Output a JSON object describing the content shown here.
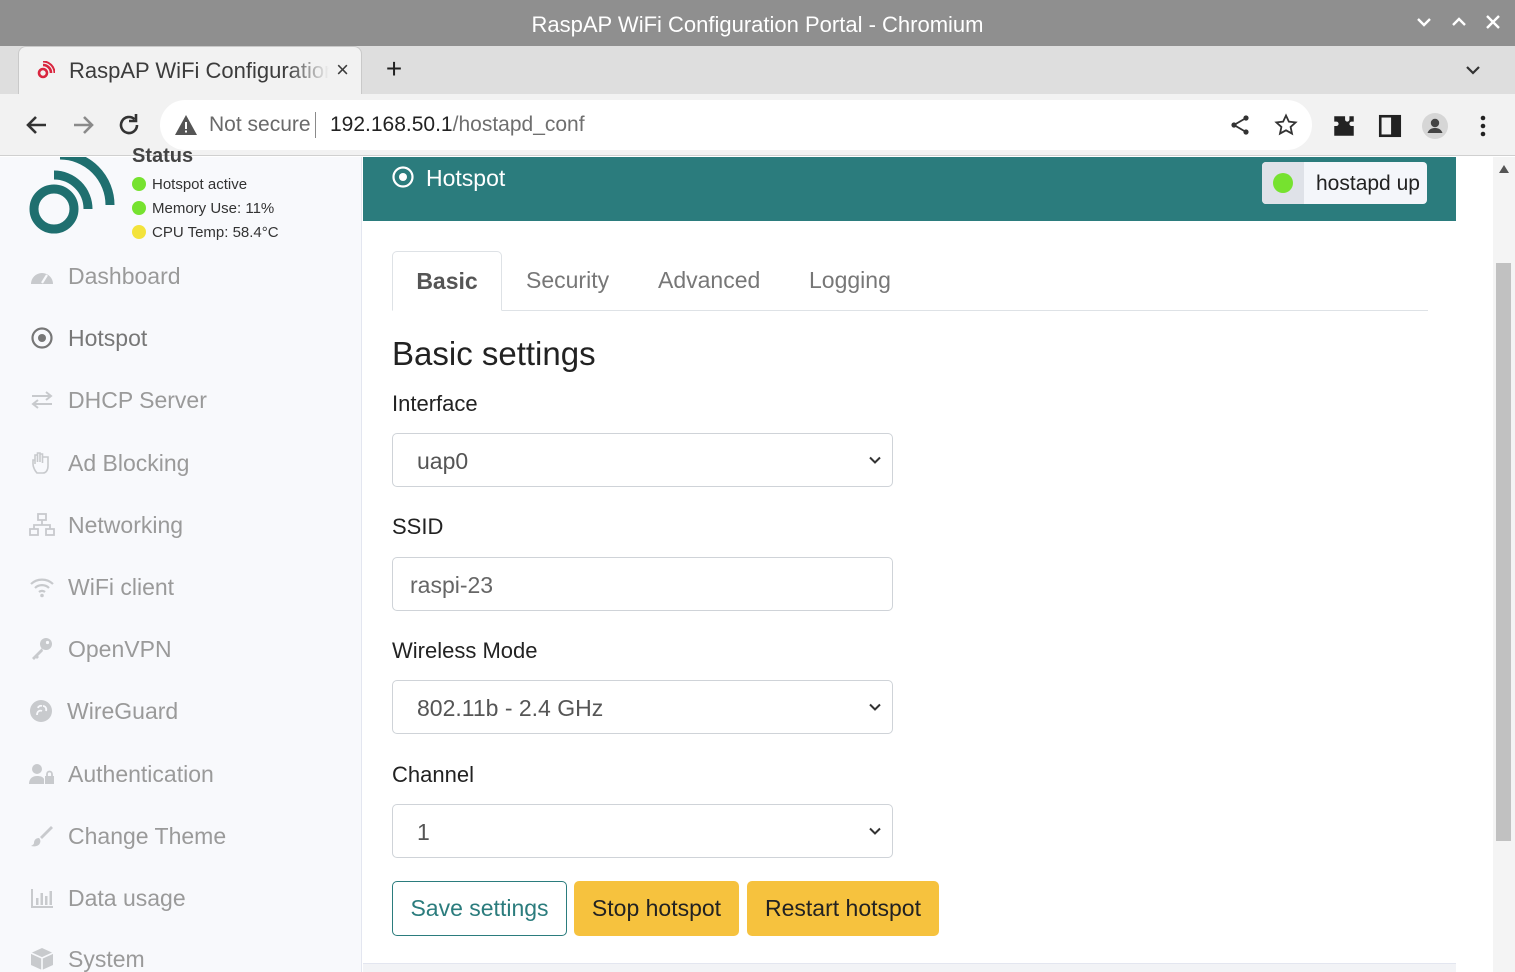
{
  "window": {
    "title": "RaspAP WiFi Configuration Portal - Chromium"
  },
  "browser": {
    "tab_title": "RaspAP WiFi Configuration Portal",
    "tab_close": "×",
    "new_tab": "+",
    "security_label": "Not secure",
    "url_host": "192.168.50.1",
    "url_path": "/hostapd_conf"
  },
  "sidebar": {
    "status_heading": "Status",
    "status": [
      {
        "label": "Hotspot active",
        "color": "#76e22f"
      },
      {
        "label": "Memory Use: 11%",
        "color": "#76e22f"
      },
      {
        "label": "CPU Temp: 58.4°C",
        "color": "#f3e33b"
      }
    ],
    "items": [
      {
        "label": "Dashboard"
      },
      {
        "label": "Hotspot"
      },
      {
        "label": "DHCP Server"
      },
      {
        "label": "Ad Blocking"
      },
      {
        "label": "Networking"
      },
      {
        "label": "WiFi client"
      },
      {
        "label": "OpenVPN"
      },
      {
        "label": "WireGuard"
      },
      {
        "label": "Authentication"
      },
      {
        "label": "Change Theme"
      },
      {
        "label": "Data usage"
      },
      {
        "label": "System"
      }
    ]
  },
  "card": {
    "title": "Hotspot",
    "badge": "hostapd up",
    "tabs": [
      "Basic",
      "Security",
      "Advanced",
      "Logging"
    ],
    "section_title": "Basic settings",
    "fields": {
      "interface": {
        "label": "Interface",
        "value": "uap0"
      },
      "ssid": {
        "label": "SSID",
        "value": "raspi-23"
      },
      "mode": {
        "label": "Wireless Mode",
        "value": "802.11b - 2.4 GHz"
      },
      "channel": {
        "label": "Channel",
        "value": "1"
      }
    },
    "buttons": {
      "save": "Save settings",
      "stop": "Stop hotspot",
      "restart": "Restart hotspot"
    }
  },
  "colors": {
    "accent": "#2b7c7d",
    "warning": "#f6c23e",
    "status_ok": "#76e22f"
  }
}
